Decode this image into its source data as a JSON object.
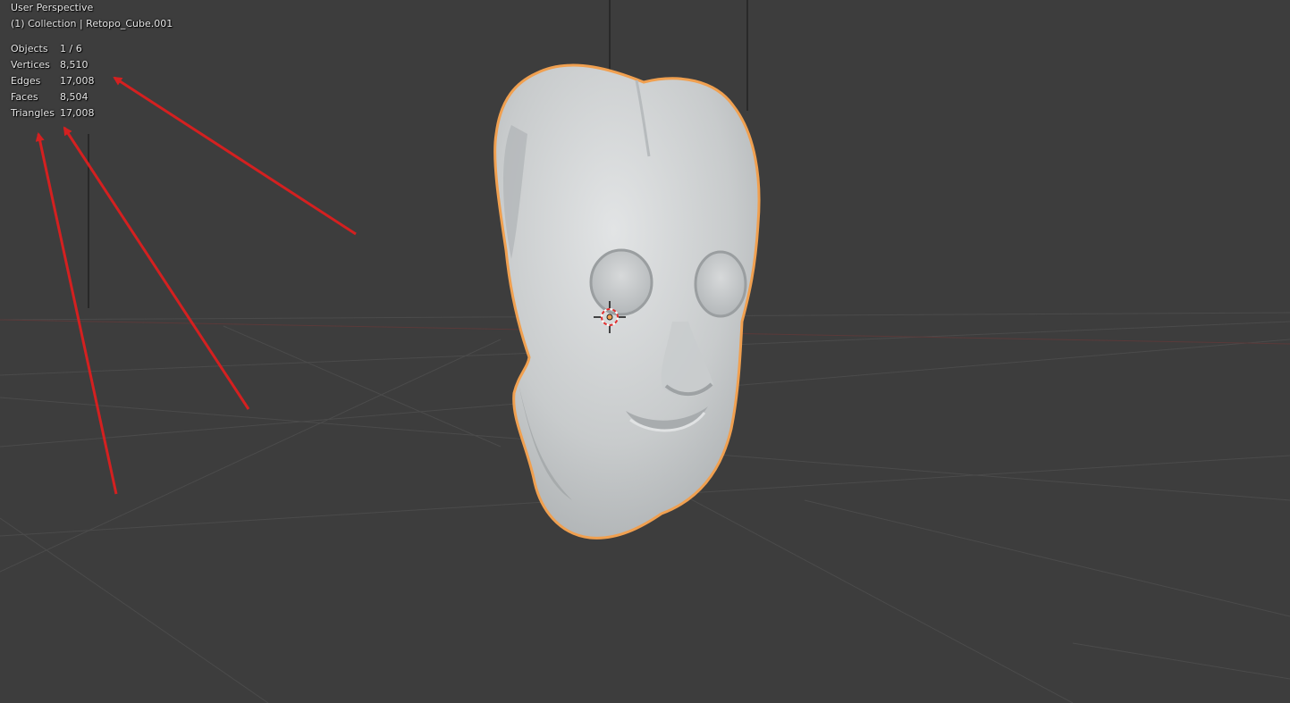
{
  "viewport": {
    "view_name": "User Perspective",
    "context": "(1) Collection | Retopo_Cube.001"
  },
  "stats": [
    {
      "label": "Objects",
      "value": "1 / 6"
    },
    {
      "label": "Vertices",
      "value": "8,510"
    },
    {
      "label": "Edges",
      "value": "17,008"
    },
    {
      "label": "Faces",
      "value": "8,504"
    },
    {
      "label": "Triangles",
      "value": "17,008"
    }
  ],
  "colors": {
    "background": "#3d3d3d",
    "grid": "#4d4d4d",
    "selection_outline": "#f0a050",
    "annotation_arrow": "#d42020",
    "mesh": "#c4c7c8"
  },
  "icons": {
    "origin": "object-origin-icon",
    "cursor": "3d-cursor-icon"
  }
}
